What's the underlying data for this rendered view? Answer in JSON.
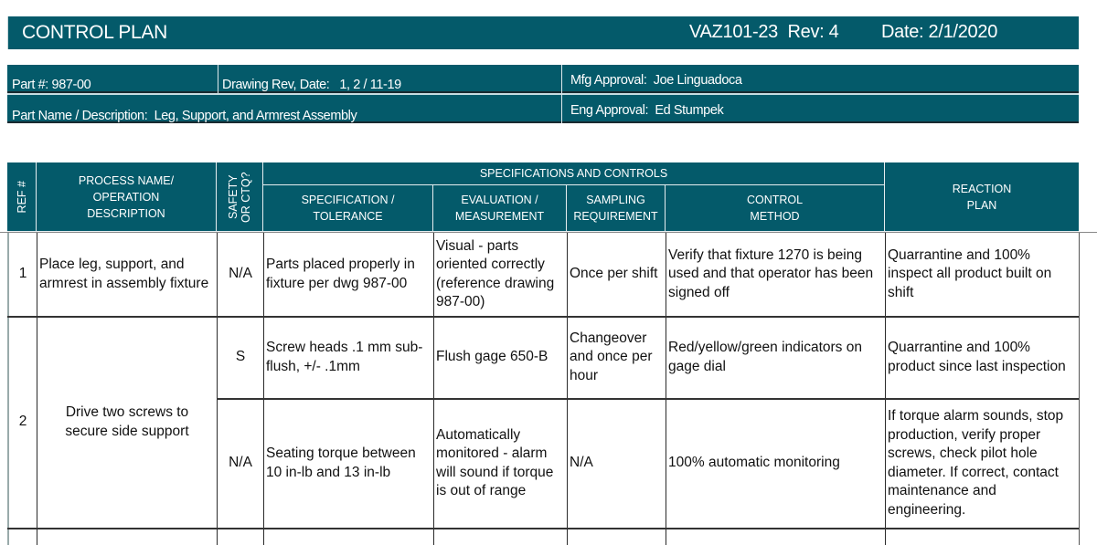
{
  "header": {
    "title": "CONTROL PLAN",
    "doc_id_rev": "VAZ101-23  Rev: 4",
    "date": "Date: 2/1/2020"
  },
  "info": {
    "part_number": "Part #: 987-00",
    "drawing_rev_date": "Drawing Rev, Date:   1, 2 / 11-19",
    "part_name": "Part Name / Description:  Leg, Support, and Armrest Assembly",
    "mfg_approval": "Mfg Approval:  Joe Linguadoca",
    "eng_approval": "Eng Approval:  Ed Stumpek"
  },
  "table": {
    "headers": {
      "ref": "REF #",
      "process": "PROCESS NAME/ OPERATION DESCRIPTION",
      "safety": "SAFETY OR CTQ?",
      "spec_group": "SPECIFICATIONS AND CONTROLS",
      "spec": "SPECIFICATION / TOLERANCE",
      "evaluation": "EVALUATION / MEASUREMENT",
      "sampling": "SAMPLING REQUIREMENT",
      "control": "CONTROL METHOD",
      "reaction": "REACTION PLAN"
    },
    "rows": [
      {
        "ref": "1",
        "process": "Place leg, support, and armrest in assembly fixture",
        "safety": "N/A",
        "spec": "Parts placed properly in fixture per dwg 987-00",
        "evaluation": "Visual - parts oriented correctly (reference drawing 987-00)",
        "sampling": "Once per shift",
        "control": "Verify that fixture 1270 is being used and that operator has been signed off",
        "reaction": "Quarrantine and 100% inspect all product built on shift"
      },
      {
        "ref": "2",
        "process": "Drive two screws to secure side support",
        "sub_rows": [
          {
            "safety": "S",
            "spec": "Screw heads .1 mm sub-flush, +/- .1mm",
            "evaluation": "Flush gage 650-B",
            "sampling": "Changeover and once per hour",
            "control": "Red/yellow/green indicators on gage dial",
            "reaction": "Quarrantine and 100% product since last inspection"
          },
          {
            "safety": "N/A",
            "spec": "Seating torque between 10 in-lb and 13 in-lb",
            "evaluation": "Automatically monitored - alarm will sound if torque is out of range",
            "sampling": "N/A",
            "control": "100% automatic monitoring",
            "reaction": "If torque alarm sounds, stop production, verify proper screws, check pilot hole diameter.  If correct, contact maintenance and engineering."
          }
        ]
      }
    ]
  },
  "colors": {
    "header_teal": "#045a6a",
    "header_text": "#ffffff",
    "grid_line": "#2a2a2a"
  }
}
